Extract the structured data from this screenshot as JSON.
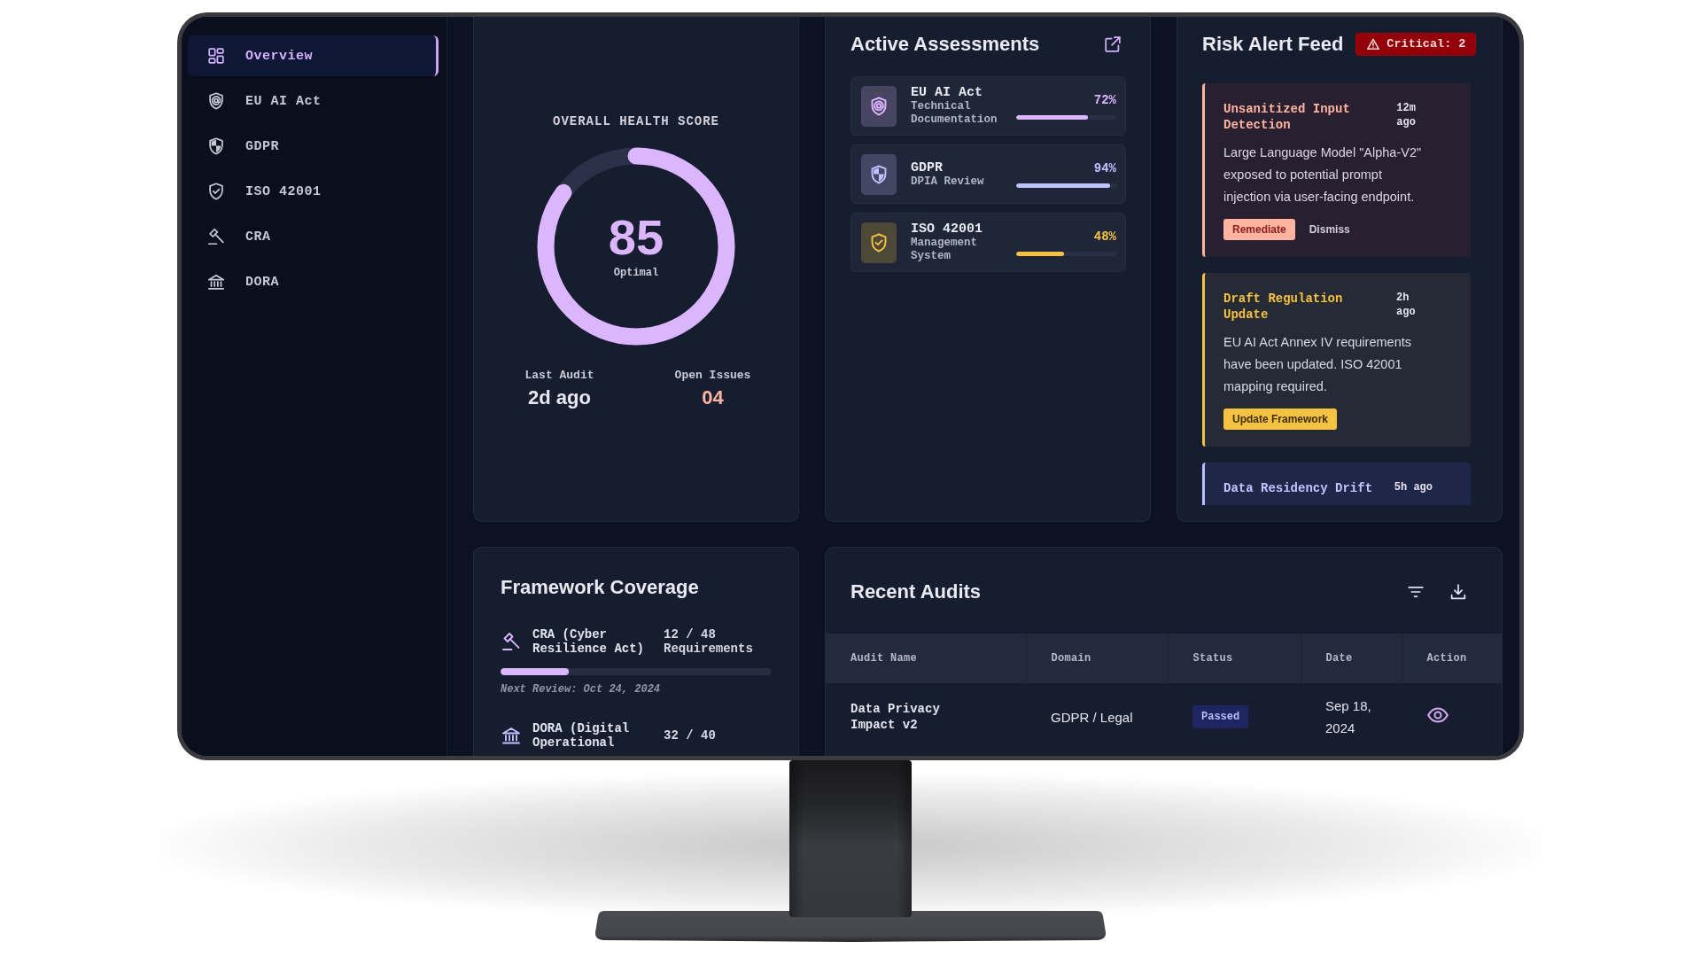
{
  "sidebar": {
    "items": [
      {
        "label": "Overview",
        "selected": true
      },
      {
        "label": "EU AI Act",
        "selected": false
      },
      {
        "label": "GDPR",
        "selected": false
      },
      {
        "label": "ISO 42001",
        "selected": false
      },
      {
        "label": "CRA",
        "selected": false
      },
      {
        "label": "DORA",
        "selected": false
      }
    ]
  },
  "health_score": {
    "title": "OVERALL HEALTH SCORE",
    "score": "85",
    "status": "Optimal",
    "level": 0.85,
    "stats": [
      {
        "label": "Last Audit",
        "value": "2d ago",
        "kind": "plain"
      },
      {
        "label": "Open Issues",
        "value": "04",
        "kind": "alert"
      }
    ]
  },
  "active_assessments": {
    "title": "Active Assessments",
    "items": [
      {
        "name": "EU AI Act",
        "detail": "Technical Documentation",
        "percent": "72%",
        "level": 0.72,
        "color": "#dcb5ff"
      },
      {
        "name": "GDPR",
        "detail": "DPIA Review",
        "percent": "94%",
        "level": 0.94,
        "color": "#bec2ff"
      },
      {
        "name": "ISO 42001",
        "detail": "Management System",
        "percent": "48%",
        "level": 0.48,
        "color": "#f5c242"
      }
    ]
  },
  "risk_alert_feed": {
    "title": "Risk Alert Feed",
    "badge": "Critical: 2",
    "alerts": [
      {
        "kind": "critical",
        "title": "Unsanitized Input Detection",
        "time": "12m ago",
        "message": "Large Language Model \"Alpha-V2\" exposed to potential prompt injection via user-facing endpoint.",
        "actions": [
          {
            "label": "Remediate",
            "kind": "primary"
          },
          {
            "label": "Dismiss",
            "kind": "text"
          }
        ]
      },
      {
        "kind": "warning",
        "title": "Draft Regulation Update",
        "time": "2h ago",
        "message": "EU AI Act Annex IV requirements have been updated. ISO 42001 mapping required.",
        "actions": [
          {
            "label": "Update Framework",
            "kind": "primary"
          }
        ]
      },
      {
        "kind": "info",
        "title": "Data Residency Drift",
        "time": "5h ago"
      }
    ]
  },
  "framework_coverage": {
    "title": "Framework Coverage",
    "items": [
      {
        "name": "CRA (Cyber Resilience Act)",
        "count": "12 / 48 Requirements",
        "level": 0.25,
        "color": "#dcb5ff",
        "next_review": "Next Review: Oct 24, 2024"
      },
      {
        "name": "DORA (Digital Operational",
        "count": "32 / 40",
        "color": "#bec2ff"
      }
    ]
  },
  "recent_audits": {
    "title": "Recent Audits",
    "table": {
      "columns": [
        "Audit Name",
        "Domain",
        "Status",
        "Date",
        "Action"
      ],
      "rows": [
        {
          "audit_name": "Data Privacy Impact v2",
          "domain": "GDPR / Legal",
          "status": {
            "label": "Passed",
            "kind": "passed"
          },
          "date": "Sep 18, 2024"
        }
      ]
    }
  }
}
